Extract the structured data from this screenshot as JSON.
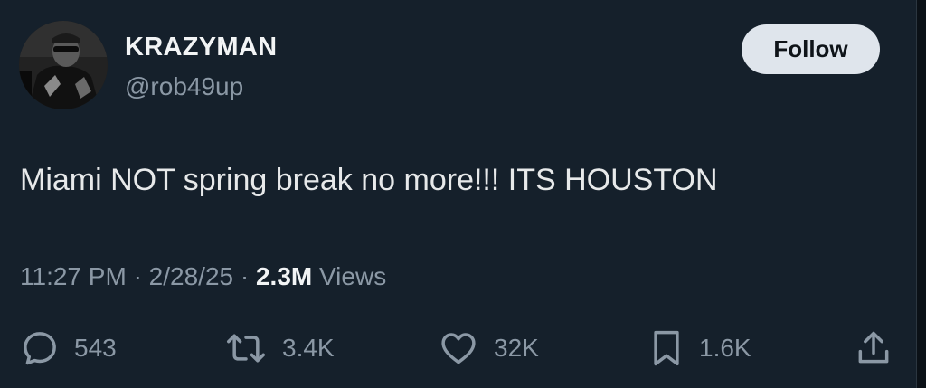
{
  "user": {
    "display_name": "KRAZYMAN",
    "handle": "@rob49up",
    "follow_label": "Follow"
  },
  "tweet": {
    "text": "Miami NOT spring break no more!!! ITS HOUSTON",
    "time": "11:27 PM",
    "separator": "·",
    "date": "2/28/25",
    "views_count": "2.3M",
    "views_label": "Views"
  },
  "actions": {
    "reply_count": "543",
    "retweet_count": "3.4K",
    "like_count": "32K",
    "bookmark_count": "1.6K"
  },
  "icons": {
    "reply": "reply-icon",
    "retweet": "retweet-icon",
    "like": "heart-icon",
    "bookmark": "bookmark-icon",
    "share": "share-icon"
  },
  "colors": {
    "background": "#15202b",
    "text_primary": "#e7e9ea",
    "text_secondary": "#8b98a5",
    "follow_bg": "#dfe5ec"
  }
}
